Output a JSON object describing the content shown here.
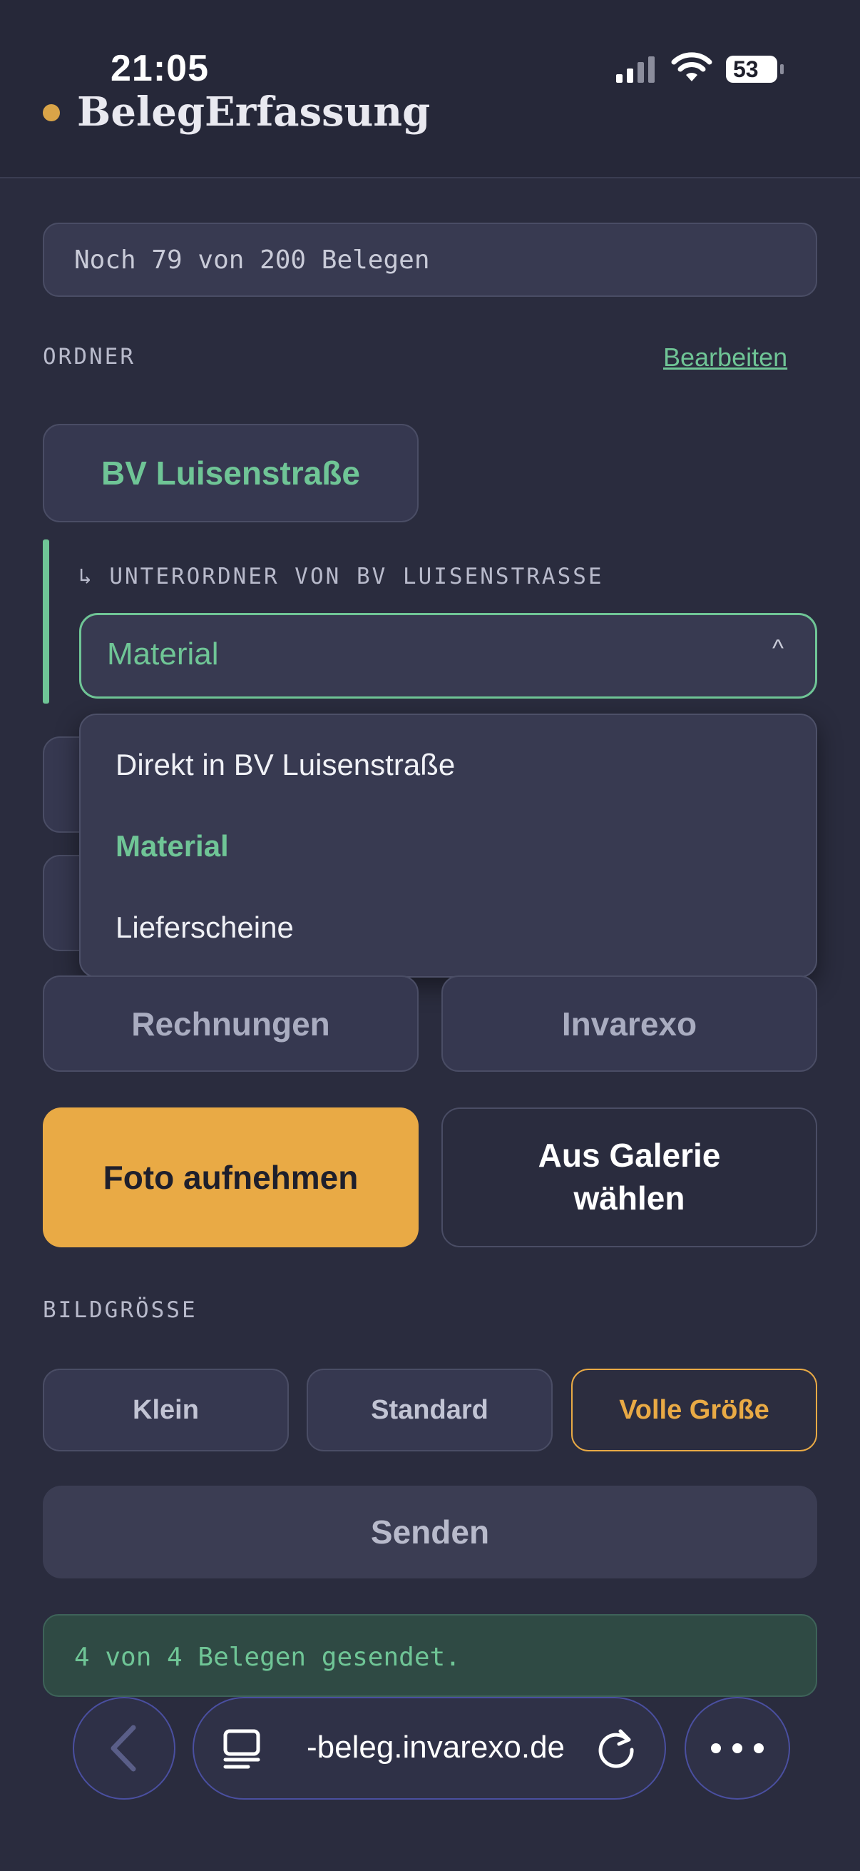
{
  "status_bar": {
    "time": "21:05",
    "battery": "53"
  },
  "header": {
    "title": "BelegErfassung"
  },
  "quota": {
    "text": "Noch 79 von 200 Belegen"
  },
  "folders": {
    "label": "ORDNER",
    "edit_label": "Bearbeiten",
    "selected": "BV Luisenstraße",
    "subfolder_label": "↳ UNTERORDNER VON BV LUISENSTRASSE",
    "subfolder_value": "Material",
    "caret": "^",
    "dropdown_options": [
      "Direkt in BV Luisenstraße",
      "Material",
      "Lieferscheine"
    ],
    "other": [
      "Rechnungen",
      "Invarexo"
    ]
  },
  "actions": {
    "photo": "Foto aufnehmen",
    "gallery": "Aus Galerie wählen"
  },
  "image_size": {
    "label": "BILDGRÖSSE",
    "options": [
      "Klein",
      "Standard",
      "Volle Größe"
    ],
    "selected": "Volle Größe"
  },
  "send": {
    "label": "Senden"
  },
  "result": {
    "text": "4 von 4 Belegen gesendet."
  },
  "browser": {
    "url": "-beleg.invarexo.de"
  },
  "colors": {
    "accent_green": "#6fc596",
    "accent_orange": "#e9aa45",
    "background": "#2a2c3e"
  }
}
